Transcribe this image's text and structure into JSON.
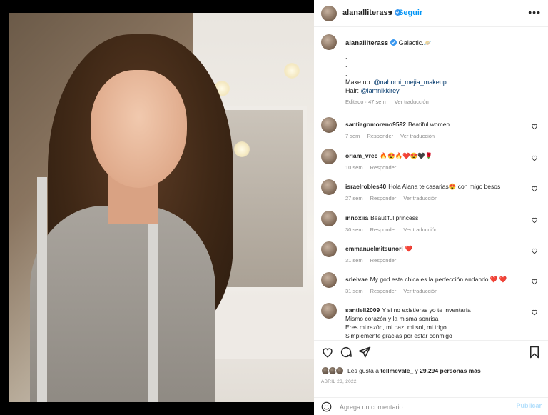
{
  "post": {
    "username": "alanalliterass",
    "follow_label": "Seguir",
    "dot": "•",
    "more_label": "•••"
  },
  "caption": {
    "username": "alanalliterass",
    "text": "Galactic.🪐",
    "bullets": [
      ".",
      ".",
      "."
    ],
    "makeup_prefix": "Make up: ",
    "makeup_mention": "@nahomi_mejia_makeup",
    "hair_prefix": "Hair: ",
    "hair_mention": "@iamnikkirey",
    "edited": "Editado · 47 sem",
    "see_translation": "Ver traducción"
  },
  "comments": [
    {
      "user": "santiagomoreno9592",
      "text": "Beatiful women",
      "time": "7 sem",
      "reply": "Responder",
      "translate": "Ver traducción"
    },
    {
      "user": "oriam_vrec",
      "text": "🔥😍🔥❤️😍🖤🌹",
      "time": "10 sem",
      "reply": "Responder",
      "translate": ""
    },
    {
      "user": "israelrobles40",
      "text": "Hola Alana te casarias😍 con migo besos",
      "time": "27 sem",
      "reply": "Responder",
      "translate": "Ver traducción"
    },
    {
      "user": "innoxiia",
      "text": "Beautiful princess",
      "time": "30 sem",
      "reply": "Responder",
      "translate": "Ver traducción"
    },
    {
      "user": "emmanuelmitsunori",
      "text": "❤️",
      "time": "31 sem",
      "reply": "Responder",
      "translate": ""
    },
    {
      "user": "srleivae",
      "text": "My god esta chica es la perfección andando ❤️ ❤️",
      "time": "31 sem",
      "reply": "Responder",
      "translate": "Ver traducción"
    },
    {
      "user": "santieli2009",
      "text": "Y si no existieras yo te inventaría",
      "extra": [
        "Mismo corazón y la misma sonrisa",
        "Eres mi razón, mi paz, mi sol, mi trigo",
        "Simplemente gracias por estar conmigo"
      ],
      "time": "",
      "reply": "",
      "translate": ""
    }
  ],
  "likes": {
    "prefix": "Les gusta a ",
    "user": "tellmevale_",
    "middle": " y ",
    "count": "29.294 personas más"
  },
  "date": "ABRIL 23, 2022",
  "add_comment": {
    "placeholder": "Agrega un comentario...",
    "post_label": "Publicar"
  },
  "icons": {
    "like": "heart-icon",
    "comment": "comment-icon",
    "share": "share-icon",
    "save": "bookmark-icon",
    "emoji": "emoji-icon"
  },
  "colors": {
    "accent": "#0095f6",
    "verified": "#3897f0",
    "muted": "#8e8e8e"
  }
}
